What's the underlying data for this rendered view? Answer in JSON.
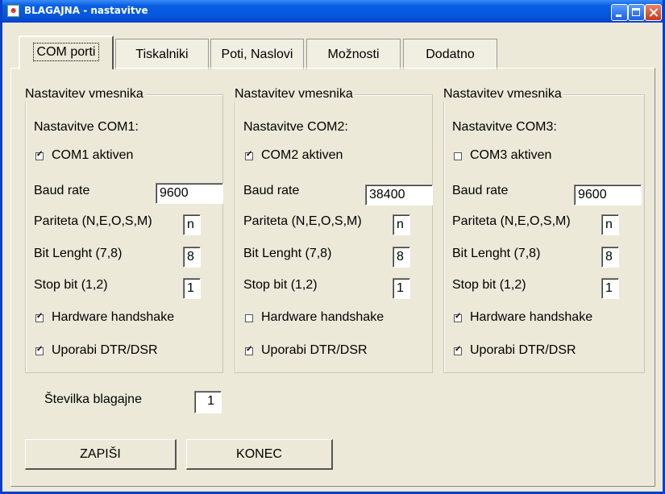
{
  "window": {
    "app_name": "BLAGAJNA",
    "subtitle": " - nastavitve"
  },
  "tabs": [
    {
      "label": "COM porti",
      "active": true
    },
    {
      "label": "Tiskalniki"
    },
    {
      "label": "Poti, Naslovi"
    },
    {
      "label": "Možnosti"
    },
    {
      "label": "Dodatno"
    }
  ],
  "groups": [
    {
      "title": "Nastavitev vmesnika",
      "heading": "Nastavitve COM1:",
      "active_label": "COM1 aktiven",
      "active_checked": true,
      "baud_label": "Baud rate",
      "baud_value": "9600",
      "parity_label": "Pariteta (N,E,O,S,M)",
      "parity_value": "n",
      "bits_label": "Bit Lenght (7,8)",
      "bits_value": "8",
      "stop_label": "Stop bit (1,2)",
      "stop_value": "1",
      "hw_label": "Hardware handshake",
      "hw_checked": true,
      "dtr_label": "Uporabi DTR/DSR",
      "dtr_checked": true
    },
    {
      "title": "Nastavitev vmesnika",
      "heading": "Nastavitve COM2:",
      "active_label": "COM2 aktiven",
      "active_checked": true,
      "baud_label": "Baud rate",
      "baud_value": "38400",
      "parity_label": "Pariteta (N,E,O,S,M)",
      "parity_value": "n",
      "bits_label": "Bit Lenght (7,8)",
      "bits_value": "8",
      "stop_label": "Stop bit (1,2)",
      "stop_value": "1",
      "hw_label": "Hardware handshake",
      "hw_checked": false,
      "dtr_label": "Uporabi DTR/DSR",
      "dtr_checked": true
    },
    {
      "title": "Nastavitev vmesnika",
      "heading": "Nastavitve COM3:",
      "active_label": "COM3 aktiven",
      "active_checked": false,
      "baud_label": "Baud rate",
      "baud_value": "9600",
      "parity_label": "Pariteta (N,E,O,S,M)",
      "parity_value": "n",
      "bits_label": "Bit Lenght (7,8)",
      "bits_value": "8",
      "stop_label": "Stop bit (1,2)",
      "stop_value": "1",
      "hw_label": "Hardware handshake",
      "hw_checked": true,
      "dtr_label": "Uporabi DTR/DSR",
      "dtr_checked": true
    }
  ],
  "register": {
    "label": "Številka blagajne",
    "value": "1"
  },
  "buttons": {
    "save": "ZAPIŠI",
    "close": "KONEC"
  }
}
